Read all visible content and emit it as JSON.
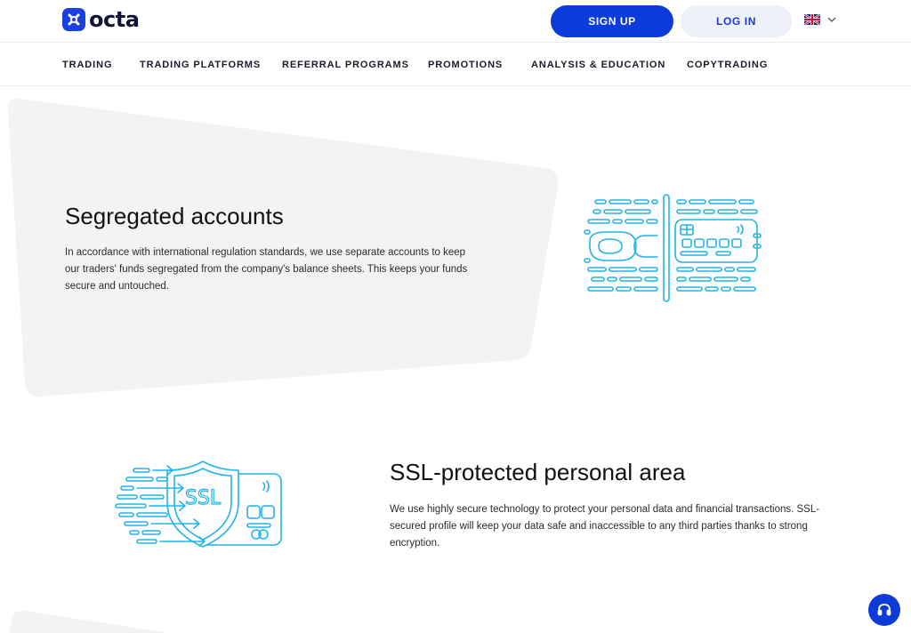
{
  "header": {
    "logo_text": "octa",
    "signup_label": "SIGN UP",
    "login_label": "LOG IN",
    "language_icon": "uk-flag-icon",
    "brand_color": "#0c3bd9"
  },
  "nav": {
    "items": [
      {
        "label": "TRADING"
      },
      {
        "label": "TRADING PLATFORMS"
      },
      {
        "label": "REFERRAL PROGRAMS"
      },
      {
        "label": "PROMOTIONS"
      },
      {
        "label": "ANALYSIS & EDUCATION"
      },
      {
        "label": "COPYTRADING"
      }
    ]
  },
  "sections": [
    {
      "title": "Segregated accounts",
      "text": "In accordance with international regulation standards, we use separate accounts to keep our traders' funds segregated from the company's balance sheets. This keeps your funds secure and untouched.",
      "icon": "segregated-accounts-illustration"
    },
    {
      "title": "SSL-protected personal area",
      "text": "We use highly secure technology to protect your personal data and financial transactions. SSL-secured profile will keep your data safe and inaccessible to any third parties thanks to strong encryption.",
      "icon": "ssl-shield-card-illustration",
      "illustration_text": "SSL"
    }
  ],
  "support": {
    "icon": "headset-icon"
  },
  "colors": {
    "illustration": "#23b4e8",
    "panel": "#f3f3f3"
  }
}
